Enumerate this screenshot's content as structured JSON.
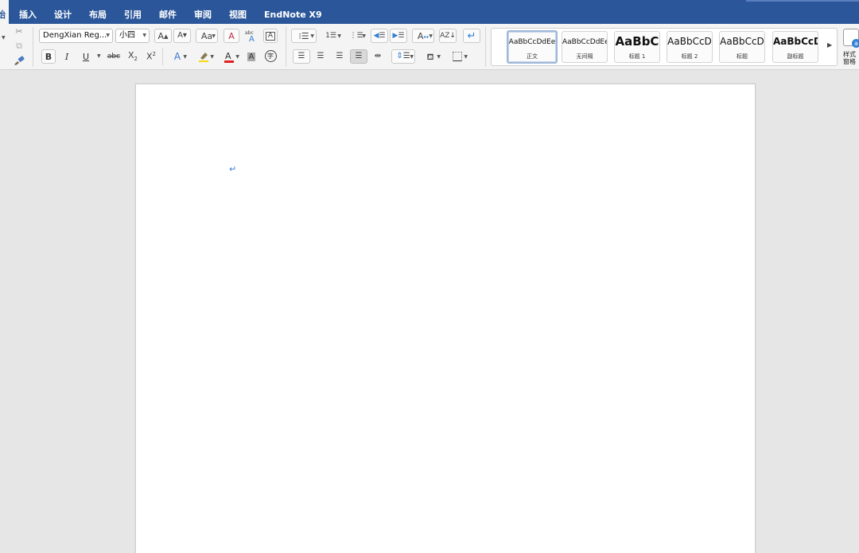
{
  "tabs": [
    {
      "label": "插入",
      "name": "tab-insert"
    },
    {
      "label": "设计",
      "name": "tab-design"
    },
    {
      "label": "布局",
      "name": "tab-layout"
    },
    {
      "label": "引用",
      "name": "tab-references"
    },
    {
      "label": "邮件",
      "name": "tab-mailings"
    },
    {
      "label": "审阅",
      "name": "tab-review"
    },
    {
      "label": "视图",
      "name": "tab-view"
    },
    {
      "label": "EndNote X9",
      "name": "tab-endnote"
    }
  ],
  "active_tab": {
    "label": "始"
  },
  "font": {
    "family": "DengXian Reg...",
    "size": "小四",
    "bold": "B",
    "italic": "I",
    "underline": "U",
    "strike": "abc",
    "char_shading": "A",
    "enclose": "字"
  },
  "styles": [
    {
      "sample": "AaBbCcDdEe",
      "name": "正文"
    },
    {
      "sample": "AaBbCcDdEe",
      "name": "无间隔"
    },
    {
      "sample": "AaBbC",
      "name": "标题 1"
    },
    {
      "sample": "AaBbCcD",
      "name": "标题 2"
    },
    {
      "sample": "AaBbCcD",
      "name": "标题"
    },
    {
      "sample": "AaBbCcD",
      "name": "副标题"
    }
  ],
  "styles_pane": {
    "label": "样式窗格"
  },
  "document": {
    "paragraph_mark": "↵"
  },
  "colors": {
    "accent": "#2b579a",
    "highlight": "#f5d90a",
    "font_color": "#e02020",
    "paragraph_mark": "#3d7ed8"
  }
}
